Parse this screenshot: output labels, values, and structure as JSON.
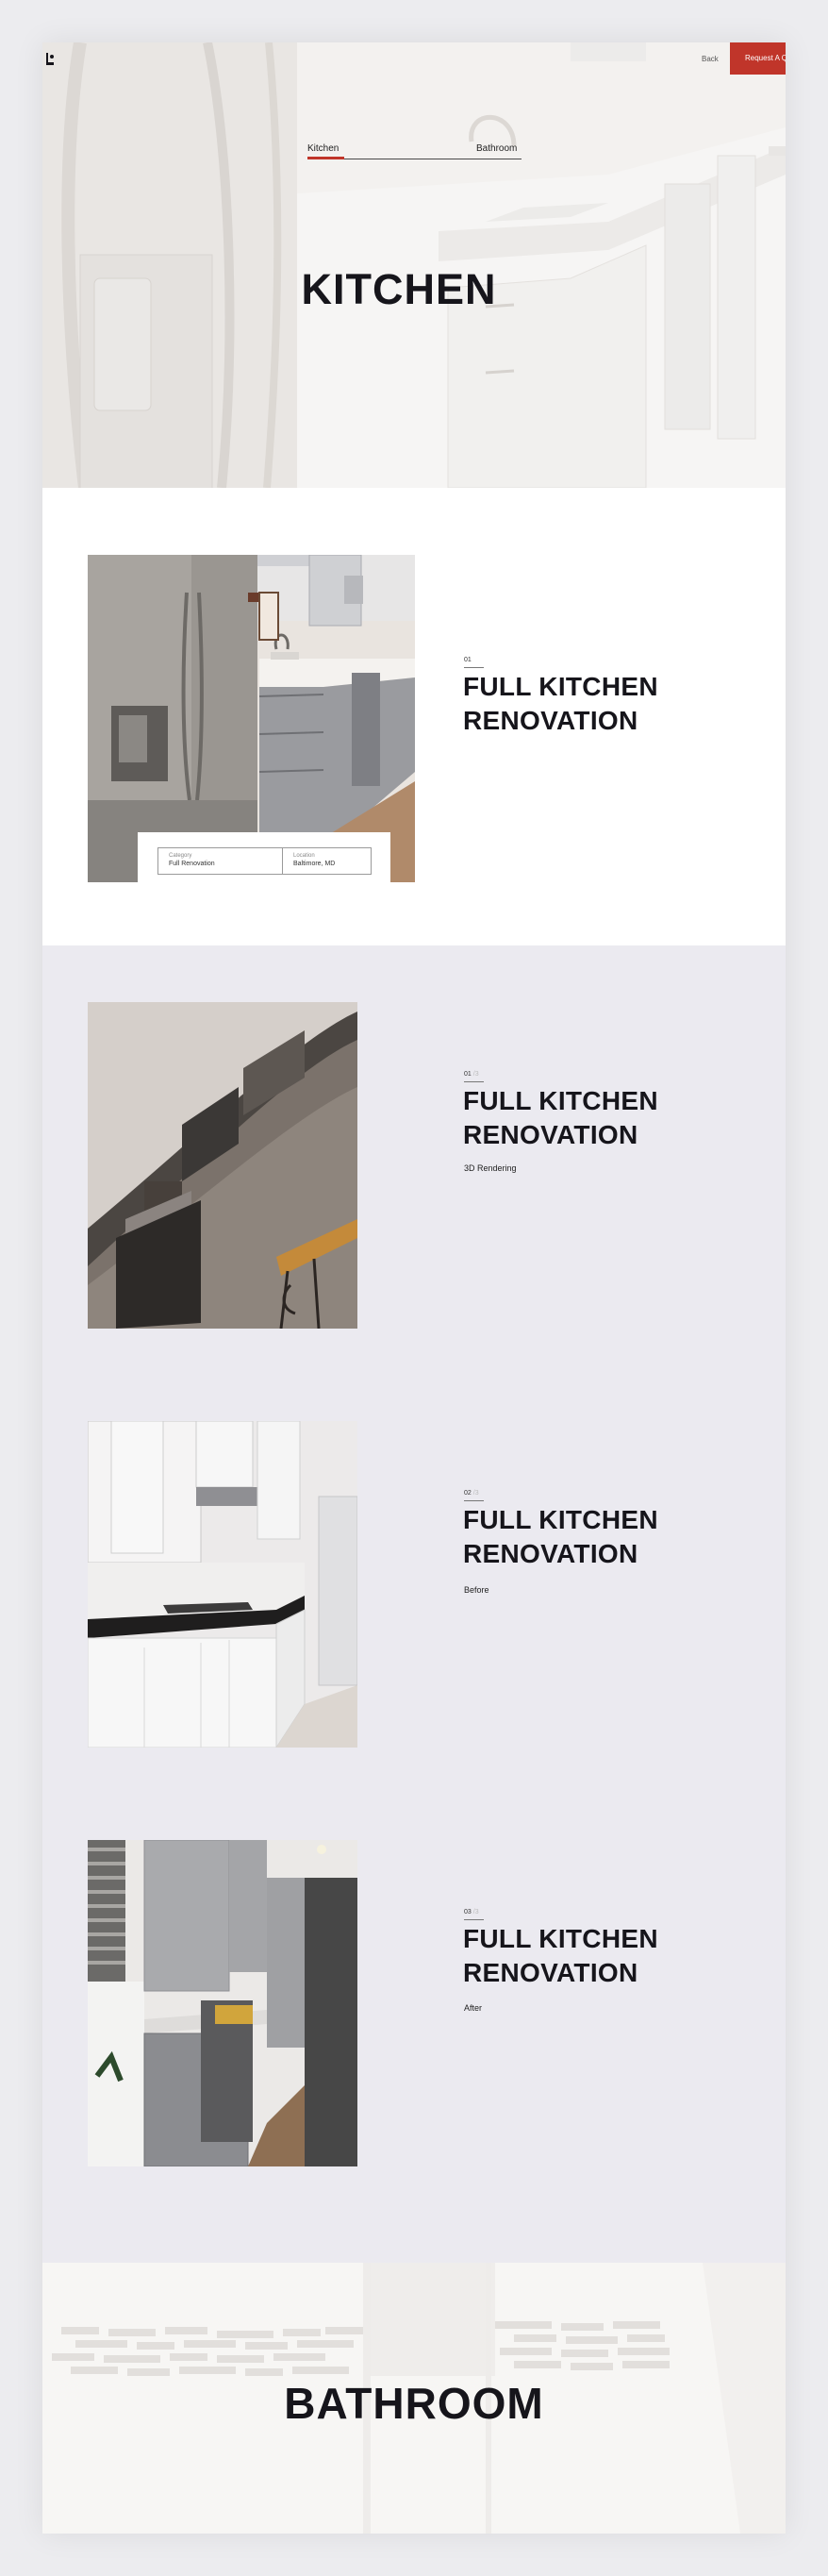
{
  "header": {
    "back_label": "Back",
    "cta_label": "Request A Quote",
    "tabs": [
      {
        "label": "Kitchen",
        "active": true
      },
      {
        "label": "Bathroom",
        "active": false
      }
    ]
  },
  "hero": {
    "title": "KITCHEN"
  },
  "featured": {
    "number": "01",
    "title_line1": "FULL KITCHEN",
    "title_line2": "RENOVATION",
    "meta": [
      {
        "key": "Category",
        "value": "Full Renovation"
      },
      {
        "key": "Location",
        "value": "Baltimore, MD"
      }
    ]
  },
  "gallery": [
    {
      "number": "01",
      "total": "/3",
      "title_line1": "FULL KITCHEN",
      "title_line2": "RENOVATION",
      "subtitle": "3D Rendering"
    },
    {
      "number": "02",
      "total": "/3",
      "title_line1": "FULL KITCHEN",
      "title_line2": "RENOVATION",
      "subtitle": "Before"
    },
    {
      "number": "03",
      "total": "/3",
      "title_line1": "FULL KITCHEN",
      "title_line2": "RENOVATION",
      "subtitle": "After"
    }
  ],
  "bathroom": {
    "title": "BATHROOM"
  },
  "colors": {
    "accent": "#c0352a",
    "text": "#16151b",
    "gallery_bg": "#ebeaf0"
  }
}
